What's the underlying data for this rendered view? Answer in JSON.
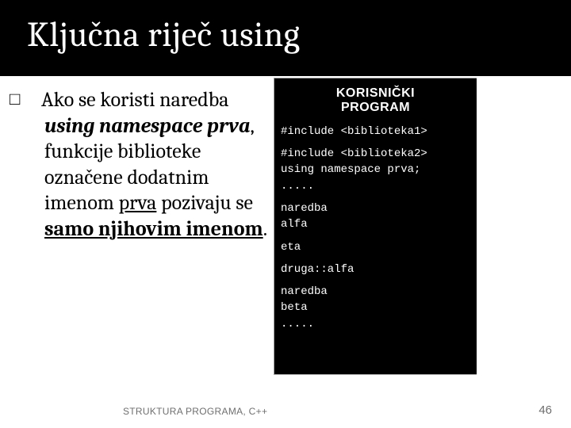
{
  "title": "Ključna riječ  using",
  "body": {
    "bullet_glyph": "□",
    "part1": "Ako se koristi naredba ",
    "em": "using namespace prva",
    "part2": ",  funkcije biblioteke označene dodatnim imenom ",
    "underlined1": "prva",
    "part3": " pozivaju se ",
    "bold_under": "samo njihovim imenom",
    "part4": "."
  },
  "code": {
    "header1": "KORISNIČKI",
    "header2": "PROGRAM",
    "lines": [
      "#include <biblioteka1>",
      "",
      "#include <biblioteka2>",
      "using namespace prva;",
      ".....",
      "",
      "naredba",
      "alfa",
      "",
      "eta",
      "",
      "druga::alfa",
      "",
      "naredba",
      "beta",
      "....."
    ]
  },
  "footer": {
    "left": "STRUKTURA PROGRAMA, C++",
    "right": "46"
  }
}
